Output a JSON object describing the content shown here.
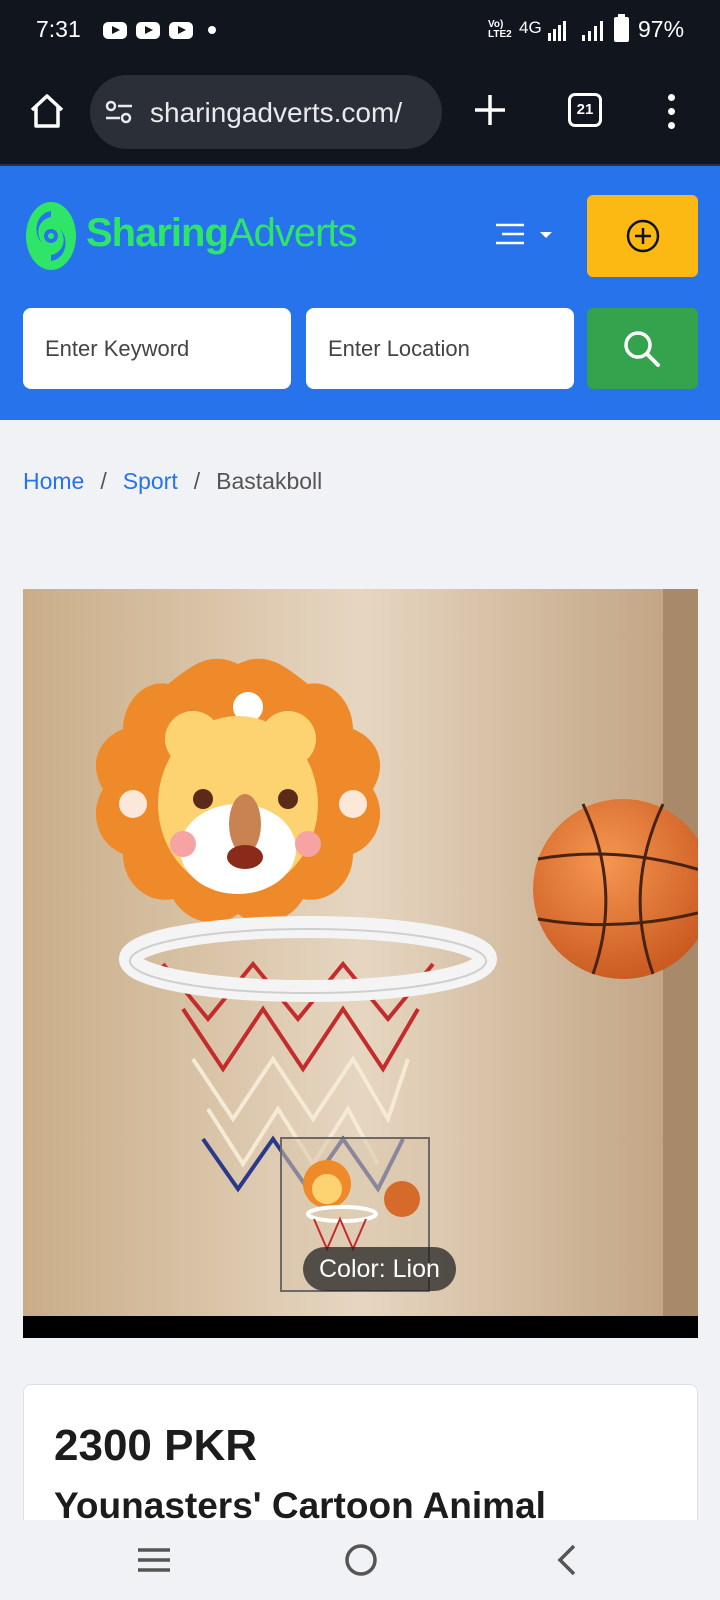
{
  "status_bar": {
    "time": "7:31",
    "volte": "Vo)\nLTE2",
    "network": "4G",
    "battery": "97%",
    "notification_icons": [
      "youtube-icon",
      "youtube-icon",
      "youtube-icon",
      "dot-icon"
    ]
  },
  "browser": {
    "url": "sharingadverts.com/",
    "tab_count": "21",
    "icons": [
      "home-icon",
      "site-settings-icon",
      "new-tab-icon",
      "tabs-icon",
      "more-icon"
    ]
  },
  "site_header": {
    "logo_part1": "Sharing",
    "logo_part2": "Adverts",
    "keyword_placeholder": "Enter Keyword",
    "location_placeholder": "Enter Location",
    "colors": {
      "header": "#2673ec",
      "post_button": "#fcb913",
      "search_button": "#35a24d",
      "logo": "#2ee568"
    }
  },
  "breadcrumb": {
    "items": [
      {
        "label": "Home",
        "link": true
      },
      {
        "label": "Sport",
        "link": true
      },
      {
        "label": "Bastakboll",
        "link": false
      }
    ],
    "separator": "/"
  },
  "product": {
    "image_badge": "Color: Lion",
    "price": "2300 PKR",
    "title": "Younasters' Cartoon Animal"
  },
  "nav_bar": {
    "icons": [
      "recent-apps-icon",
      "home-circle-icon",
      "back-icon"
    ]
  }
}
